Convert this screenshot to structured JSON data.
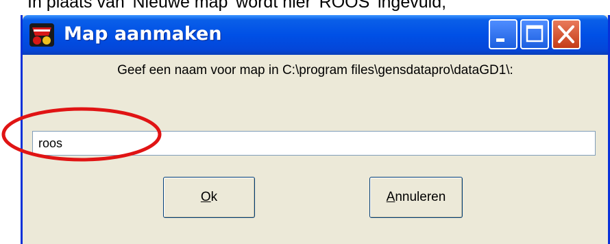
{
  "caption": "In plaats van 'Nieuwe map' wordt hier 'ROOS' ingevuld;",
  "window": {
    "title": "Map aanmaken",
    "app_icon": "gensdatapro-logo-icon",
    "titlebar_color": "#0050e6",
    "controls": [
      "minimize-icon",
      "maximize-icon",
      "close-icon"
    ]
  },
  "dialog": {
    "prompt": "Geef een naam voor map in C:\\program files\\gensdatapro\\dataGD1\\:",
    "input_value": "roos",
    "ok_accesskey": "O",
    "ok_rest": "k",
    "cancel_accesskey": "A",
    "cancel_rest": "nnuleren"
  },
  "annotation": {
    "shape": "ellipse",
    "color": "#e01414"
  }
}
